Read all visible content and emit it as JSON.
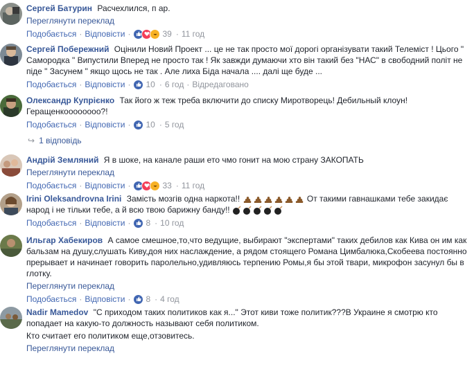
{
  "ui": {
    "translate_label": "Переглянути переклад",
    "like_label": "Подобається",
    "reply_label": "Відповісти",
    "separator": "·",
    "edited_label": "Відредаговано"
  },
  "colors": {
    "link": "#385898",
    "action": "#4267b2",
    "meta": "#90949c",
    "text": "#1d2129",
    "like": "#4267b2",
    "love": "#f33e58",
    "haha": "#f7b125"
  },
  "comments": [
    {
      "author": "Сергей Батурин",
      "text": "Расчехлился, п   ар.",
      "reactions": [
        "like",
        "love",
        "haha"
      ],
      "count": "39",
      "time": "11 год"
    },
    {
      "author": "Сергей Побережний",
      "text": "Оцінили Новий Проект ... це не так просто мої дорогі організувати такий Телеміст ! Цього \" Самородка \" Випустили Вперед не просто так ! Як завжди думаючи хто він такий без \"НАС\" в свободний політ не піде \" Засунем \" якщо щось не так . Але лиха Біда начала .... далі ще буде ...",
      "reactions": [
        "like"
      ],
      "count": "10",
      "time": "6 год",
      "edited": true
    },
    {
      "author": "Олександр Купрієнко",
      "text": "Так його ж теж треба включити до списку Миротворець! Дебильный клоун! Геращенкоооооооо?!",
      "reactions": [
        "like"
      ],
      "count": "10",
      "time": "5 год"
    },
    {
      "replies_label": "1 відповідь"
    },
    {
      "author": "Андрій Земляний",
      "text": "Я в шоке, на канале раши ето чмо гонит на мою страну ЗАКОПАТЬ",
      "reactions": [
        "like",
        "love",
        "haha"
      ],
      "count": "33",
      "time": "11 год"
    },
    {
      "author": "Irini Oleksandrovna Irini",
      "text_before": "Замість мозгів одна наркота!!",
      "text_middle": "От такими гавнашками тебе закидає народ і не тільки тебе, а й всю твою барижну банду!!",
      "emoji_poo": "💩",
      "emoji_bomb": "💣",
      "reactions": [
        "like"
      ],
      "count": "8",
      "time": "10 год"
    },
    {
      "author": "Ильгар Хабекиров",
      "text": "А самое смешное,то,что ведущие, выбирают \"экспертами\" таких дебилов как Кива он им как бальзам на душу,слушать Киву,доя них наслаждение, а рядом стоящего Романа Цимбалюка,Скобеева постоянно прерывает и начинает говорить паролельно,удивляюсь терпению Ромы,я бы этой твари, микрофон засунул бы в глотку.",
      "reactions": [
        "like"
      ],
      "count": "8",
      "time": "4 год"
    },
    {
      "author": "Nadir Mamedov",
      "text": "\"С приходом таких политиков как я...\" Этот киви тоже политик???В Украине я смотрю кто попадает на какую-то должность называют себя политиком.",
      "text2": "Кто считает его политиком еще,отзовитесь."
    }
  ]
}
